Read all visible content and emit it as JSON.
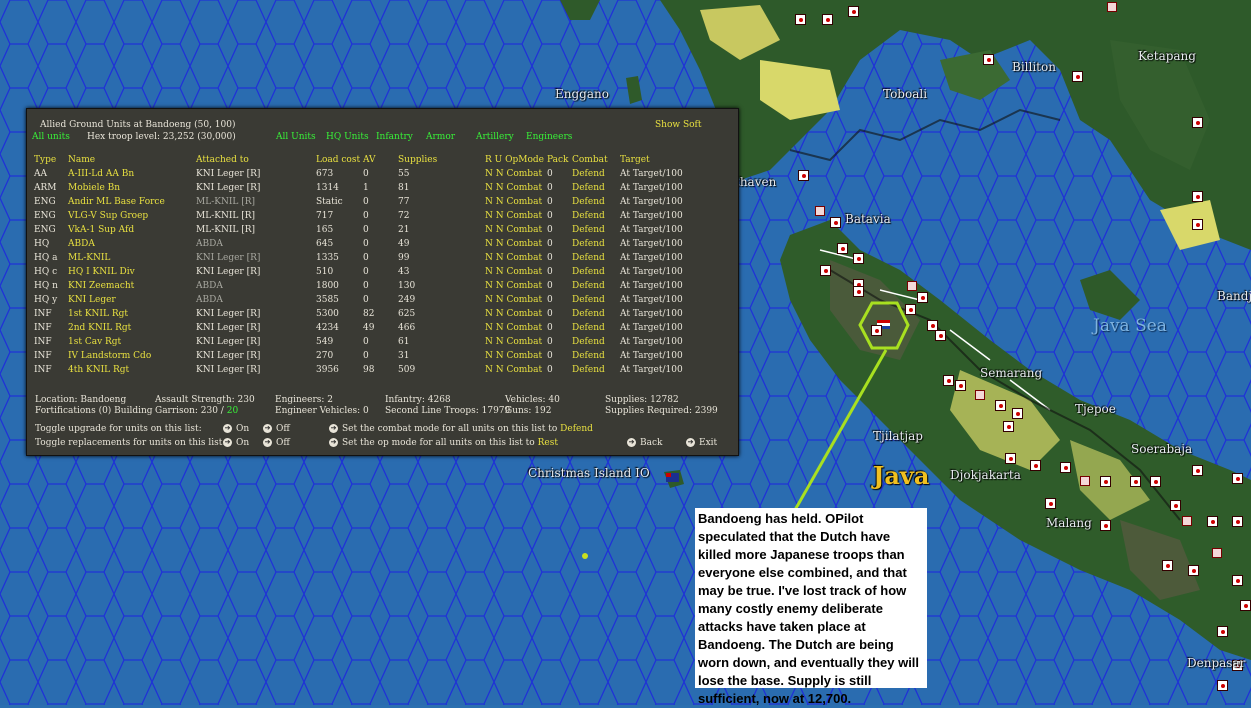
{
  "map": {
    "labels": [
      {
        "id": "enggano",
        "text": "Enggano"
      },
      {
        "id": "toboali",
        "text": "Toboali"
      },
      {
        "id": "billiton",
        "text": "Billiton"
      },
      {
        "id": "ketapang",
        "text": "Ketapang"
      },
      {
        "id": "thaven",
        "text": "thaven"
      },
      {
        "id": "batavia",
        "text": "Batavia"
      },
      {
        "id": "bandj",
        "text": "Bandj"
      },
      {
        "id": "javasea",
        "text": "Java Sea"
      },
      {
        "id": "semarang",
        "text": "Semarang"
      },
      {
        "id": "tjepoe",
        "text": "Tjepoe"
      },
      {
        "id": "tjilatjap",
        "text": "Tjilatjap"
      },
      {
        "id": "soerabaja",
        "text": "Soerabaja"
      },
      {
        "id": "java",
        "text": "Java"
      },
      {
        "id": "djokjakarta",
        "text": "Djokjakarta"
      },
      {
        "id": "christmas",
        "text": "Christmas Island IO"
      },
      {
        "id": "malang",
        "text": "Malang"
      },
      {
        "id": "denpasar",
        "text": "Denpasar"
      }
    ],
    "colors": {
      "sea": "#2b6fb0",
      "hexline": "#1a2ad0",
      "jungle": "#2f5a2a",
      "clear": "#e0e070",
      "highlight": "#a8e020"
    }
  },
  "panel": {
    "title": "Allied Ground Units at Bandoeng  (50, 100)",
    "subtitle_left": "All units",
    "hex_troop_level": "Hex troop level: 23,252  (30,000)",
    "filters": [
      "All Units",
      "HQ Units",
      "Infantry",
      "Armor",
      "Artillery",
      "Engineers"
    ],
    "show_soft": "Show Soft",
    "columns": [
      "Type",
      "Name",
      "Attached to",
      "Load cost",
      "AV",
      "Supplies",
      "R U OpMode",
      "Pack",
      "Combat",
      "Target"
    ],
    "rows": [
      {
        "type": "AA",
        "name": "A-III-Ld AA Bn",
        "attached": "KNI Leger [R]",
        "load": "673",
        "av": "0",
        "supplies": "55",
        "ru": "N N Combat",
        "pack": "0",
        "combat": "Defend",
        "target": "At Target/100",
        "att_gray": false
      },
      {
        "type": "ARM",
        "name": "Mobiele Bn",
        "attached": "KNI Leger [R]",
        "load": "1314",
        "av": "1",
        "supplies": "81",
        "ru": "N N Combat",
        "pack": "0",
        "combat": "Defend",
        "target": "At Target/100",
        "att_gray": false
      },
      {
        "type": "ENG",
        "name": "Andir ML Base Force",
        "attached": "ML-KNIL [R]",
        "load": "Static",
        "av": "0",
        "supplies": "77",
        "ru": "N N Combat",
        "pack": "0",
        "combat": "Defend",
        "target": "At Target/100",
        "att_gray": true
      },
      {
        "type": "ENG",
        "name": "VLG-V Sup Groep",
        "attached": "ML-KNIL [R]",
        "load": "717",
        "av": "0",
        "supplies": "72",
        "ru": "N N Combat",
        "pack": "0",
        "combat": "Defend",
        "target": "At Target/100",
        "att_gray": false
      },
      {
        "type": "ENG",
        "name": "VkA-1 Sup Afd",
        "attached": "ML-KNIL [R]",
        "load": "165",
        "av": "0",
        "supplies": "21",
        "ru": "N N Combat",
        "pack": "0",
        "combat": "Defend",
        "target": "At Target/100",
        "att_gray": false
      },
      {
        "type": "HQ",
        "name": "ABDA",
        "attached": "ABDA",
        "load": "645",
        "av": "0",
        "supplies": "49",
        "ru": "N N Combat",
        "pack": "0",
        "combat": "Defend",
        "target": "At Target/100",
        "att_gray": true
      },
      {
        "type": "HQ a",
        "name": "ML-KNIL",
        "attached": "KNI Leger [R]",
        "load": "1335",
        "av": "0",
        "supplies": "99",
        "ru": "N N Combat",
        "pack": "0",
        "combat": "Defend",
        "target": "At Target/100",
        "att_gray": true
      },
      {
        "type": "HQ c",
        "name": "HQ I KNIL Div",
        "attached": "KNI Leger [R]",
        "load": "510",
        "av": "0",
        "supplies": "43",
        "ru": "N N Combat",
        "pack": "0",
        "combat": "Defend",
        "target": "At Target/100",
        "att_gray": false
      },
      {
        "type": "HQ n",
        "name": "KNI Zeemacht",
        "attached": "ABDA",
        "load": "1800",
        "av": "0",
        "supplies": "130",
        "ru": "N N Combat",
        "pack": "0",
        "combat": "Defend",
        "target": "At Target/100",
        "att_gray": true
      },
      {
        "type": "HQ y",
        "name": "KNI Leger",
        "attached": "ABDA",
        "load": "3585",
        "av": "0",
        "supplies": "249",
        "ru": "N N Combat",
        "pack": "0",
        "combat": "Defend",
        "target": "At Target/100",
        "att_gray": true
      },
      {
        "type": "INF",
        "name": "1st KNIL Rgt",
        "attached": "KNI Leger [R]",
        "load": "5300",
        "av": "82",
        "supplies": "625",
        "ru": "N N Combat",
        "pack": "0",
        "combat": "Defend",
        "target": "At Target/100",
        "att_gray": false
      },
      {
        "type": "INF",
        "name": "2nd KNIL Rgt",
        "attached": "KNI Leger [R]",
        "load": "4234",
        "av": "49",
        "supplies": "466",
        "ru": "N N Combat",
        "pack": "0",
        "combat": "Defend",
        "target": "At Target/100",
        "att_gray": false
      },
      {
        "type": "INF",
        "name": "1st Cav Rgt",
        "attached": "KNI Leger [R]",
        "load": "549",
        "av": "0",
        "supplies": "61",
        "ru": "N N Combat",
        "pack": "0",
        "combat": "Defend",
        "target": "At Target/100",
        "att_gray": false
      },
      {
        "type": "INF",
        "name": "IV Landstorm Cdo",
        "attached": "KNI Leger [R]",
        "load": "270",
        "av": "0",
        "supplies": "31",
        "ru": "N N Combat",
        "pack": "0",
        "combat": "Defend",
        "target": "At Target/100",
        "att_gray": false
      },
      {
        "type": "INF",
        "name": "4th KNIL Rgt",
        "attached": "KNI Leger [R]",
        "load": "3956",
        "av": "98",
        "supplies": "509",
        "ru": "N N Combat",
        "pack": "0",
        "combat": "Defend",
        "target": "At Target/100",
        "att_gray": false
      }
    ],
    "summary": {
      "location": "Location: Bandoeng",
      "fortifications": "Fortifications (0) Building",
      "assault": "Assault Strength: 230",
      "garrison_label": "Garrison: 230 /",
      "garrison_value": "20",
      "engineers": "Engineers: 2",
      "engineer_vehicles": "Engineer Vehicles: 0",
      "infantry": "Infantry: 4268",
      "second_line": "Second Line Troops: 17979",
      "vehicles": "Vehicles: 40",
      "guns": "Guns: 192",
      "supplies": "Supplies: 12782",
      "supplies_required": "Supplies Required: 2399"
    },
    "controls": {
      "toggle_upgrade": "Toggle upgrade for units on this list:",
      "toggle_replacements": "Toggle replacements for units on this list:",
      "on": "On",
      "off": "Off",
      "set_combat": "Set the combat mode for all units on this list to",
      "combat_value": "Defend",
      "set_op": "Set the op mode for all units on this list to",
      "op_value": "Rest",
      "back": "Back",
      "exit": "Exit"
    }
  },
  "note": "Bandoeng has held.  OPilot speculated that the Dutch have killed more Japanese troops than everyone else combined, and that may be true.  I've lost track of how many costly enemy deliberate attacks have taken place at Bandoeng.  The Dutch are being worn down, and eventually they will lose the base.  Supply is still sufficient, now at 12,700."
}
